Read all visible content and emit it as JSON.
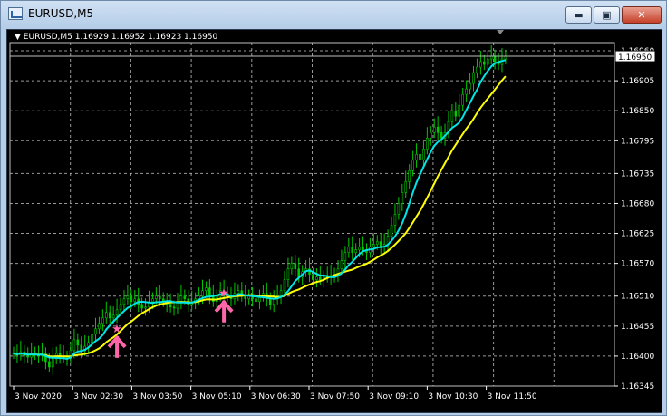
{
  "window": {
    "title": "EURUSD,M5"
  },
  "window_buttons": {
    "minimize": "▬",
    "maximize": "▣",
    "close": "✕"
  },
  "chart": {
    "symbol_label": "EURUSD,M5",
    "ohlc": "1.16929 1.16952 1.16923 1.16950",
    "current_price": "1.16950"
  },
  "colors": {
    "background": "#000000",
    "grid": "#c0c0c0",
    "candles": "#00c800",
    "ma_fast": "#00e5e5",
    "ma_slow": "#ffff00",
    "signal": "#ff66aa",
    "axis_text": "#ffffff"
  },
  "chart_data": {
    "type": "line",
    "title": "",
    "xlabel": "",
    "ylabel": "",
    "ylim": [
      1.16345,
      1.16975
    ],
    "y_ticks": [
      "1.16960",
      "1.16905",
      "1.16850",
      "1.16795",
      "1.16735",
      "1.16680",
      "1.16625",
      "1.16570",
      "1.16510",
      "1.16455",
      "1.16400",
      "1.16345"
    ],
    "x_ticks": [
      "3 Nov 2020",
      "3 Nov 02:30",
      "3 Nov 03:50",
      "3 Nov 05:10",
      "3 Nov 06:30",
      "3 Nov 07:50",
      "3 Nov 09:10",
      "3 Nov 10:30",
      "3 Nov 11:50"
    ],
    "x": [
      0,
      1,
      2,
      3,
      4,
      5,
      6,
      7,
      8,
      9,
      10,
      11,
      12,
      13,
      14,
      15,
      16,
      17,
      18,
      19,
      20,
      21,
      22,
      23,
      24,
      25,
      26,
      27,
      28,
      29,
      30,
      31,
      32,
      33,
      34,
      35,
      36,
      37,
      38,
      39,
      40,
      41,
      42,
      43,
      44,
      45,
      46,
      47,
      48,
      49,
      50,
      51,
      52,
      53,
      54,
      55,
      56,
      57,
      58,
      59,
      60,
      61,
      62,
      63,
      64,
      65,
      66,
      67,
      68,
      69,
      70,
      71,
      72,
      73,
      74,
      75,
      76,
      77,
      78,
      79,
      80,
      81,
      82,
      83,
      84,
      85,
      86,
      87,
      88,
      89,
      90,
      91,
      92,
      93,
      94,
      95,
      96,
      97,
      98,
      99,
      100,
      101,
      102,
      103,
      104,
      105,
      106,
      107,
      108,
      109,
      110,
      111,
      112,
      113,
      114,
      115,
      116,
      117,
      118,
      119,
      120,
      121,
      122,
      123,
      124,
      125,
      126,
      127,
      128,
      129,
      130,
      131,
      132,
      133,
      134,
      135,
      136,
      137,
      138,
      139,
      140,
      141,
      142,
      143,
      144,
      145,
      146,
      147,
      148,
      149,
      150,
      151,
      152,
      153,
      154,
      155,
      156,
      157,
      158,
      159,
      160,
      161,
      162,
      163,
      164,
      165,
      166,
      167
    ],
    "series": [
      {
        "values": [
          1.16405,
          1.16402,
          1.16408,
          1.164,
          1.16398,
          1.16405,
          1.16403,
          1.16401,
          1.16404,
          1.1639,
          1.1638,
          1.16395,
          1.16405,
          1.164,
          1.16398,
          1.16396,
          1.1641,
          1.1643,
          1.1642,
          1.1641,
          1.16418,
          1.16425,
          1.1644,
          1.1645,
          1.1646,
          1.1647,
          1.1648,
          1.1647,
          1.16475,
          1.16485,
          1.16495,
          1.16505,
          1.1651,
          1.165,
          1.16505,
          1.16495,
          1.16488,
          1.1649,
          1.165,
          1.16505,
          1.1651,
          1.16505,
          1.165,
          1.16495,
          1.1649,
          1.16488,
          1.165,
          1.1651,
          1.16505,
          1.16495,
          1.165,
          1.16505,
          1.1651,
          1.1652,
          1.16525,
          1.1651,
          1.165,
          1.1651,
          1.1652,
          1.16515,
          1.1651,
          1.16505,
          1.16515,
          1.1652,
          1.1651,
          1.16505,
          1.1651,
          1.16505,
          1.165,
          1.1651,
          1.16515,
          1.16505,
          1.16495,
          1.16505,
          1.1651,
          1.1652,
          1.1654,
          1.1656,
          1.1657,
          1.1656,
          1.16545,
          1.16555,
          1.1656,
          1.1655,
          1.1654,
          1.16545,
          1.1654,
          1.16545,
          1.16548,
          1.16545,
          1.1655,
          1.1656,
          1.16575,
          1.1659,
          1.166,
          1.1659,
          1.16595,
          1.166,
          1.16595,
          1.1659,
          1.166,
          1.16605,
          1.1661,
          1.166,
          1.16605,
          1.1662,
          1.1664,
          1.1666,
          1.1668,
          1.167,
          1.1672,
          1.1674,
          1.1676,
          1.1677,
          1.1676,
          1.1678,
          1.168,
          1.1681,
          1.1682,
          1.1681,
          1.168,
          1.1681,
          1.1683,
          1.1685,
          1.1684,
          1.1686,
          1.1688,
          1.1689,
          1.169,
          1.1692,
          1.1693,
          1.1694,
          1.16935,
          1.16945,
          1.1695,
          1.1694,
          1.16935,
          1.16945,
          1.1695
        ]
      }
    ]
  }
}
